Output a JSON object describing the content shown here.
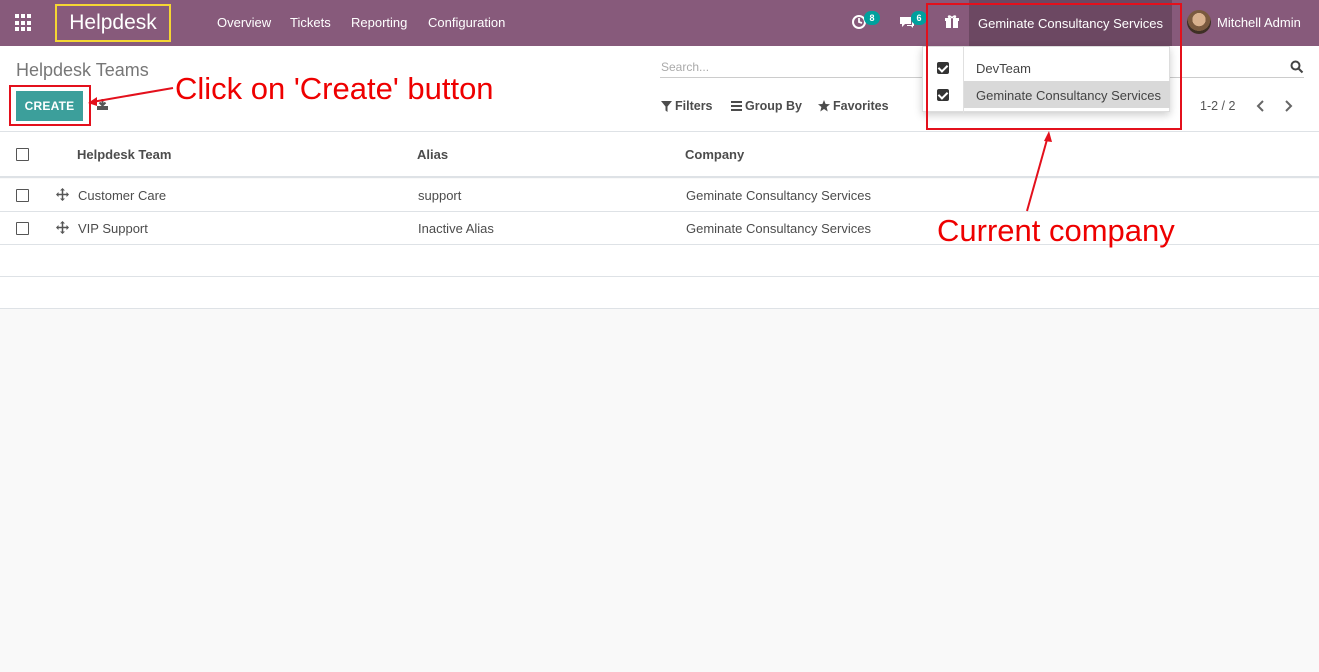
{
  "navbar": {
    "app_name": "Helpdesk",
    "menu": [
      "Overview",
      "Tickets",
      "Reporting",
      "Configuration"
    ],
    "activity_count": "8",
    "messages_count": "6",
    "company": "Geminate Consultancy Services",
    "user": "Mitchell Admin"
  },
  "control_panel": {
    "breadcrumb": "Helpdesk Teams",
    "create_label": "CREATE",
    "search_placeholder": "Search...",
    "filters_label": "Filters",
    "groupby_label": "Group By",
    "favorites_label": "Favorites",
    "pager": "1-2 / 2"
  },
  "company_dropdown": {
    "items": [
      {
        "label": "DevTeam",
        "checked": true
      },
      {
        "label": "Geminate Consultancy Services",
        "checked": true
      }
    ]
  },
  "table": {
    "columns": [
      "Helpdesk Team",
      "Alias",
      "Company"
    ],
    "rows": [
      [
        "Customer Care",
        "support",
        "Geminate Consultancy Services"
      ],
      [
        "VIP Support",
        "Inactive Alias",
        "Geminate Consultancy Services"
      ]
    ]
  },
  "annotations": {
    "create_note": "Click on 'Create' button",
    "company_note": "Current company",
    "color": "#e3101c"
  },
  "colors": {
    "navbar": "#875a7b",
    "primary_button": "#3c9f9b",
    "badge": "#00a09d"
  }
}
